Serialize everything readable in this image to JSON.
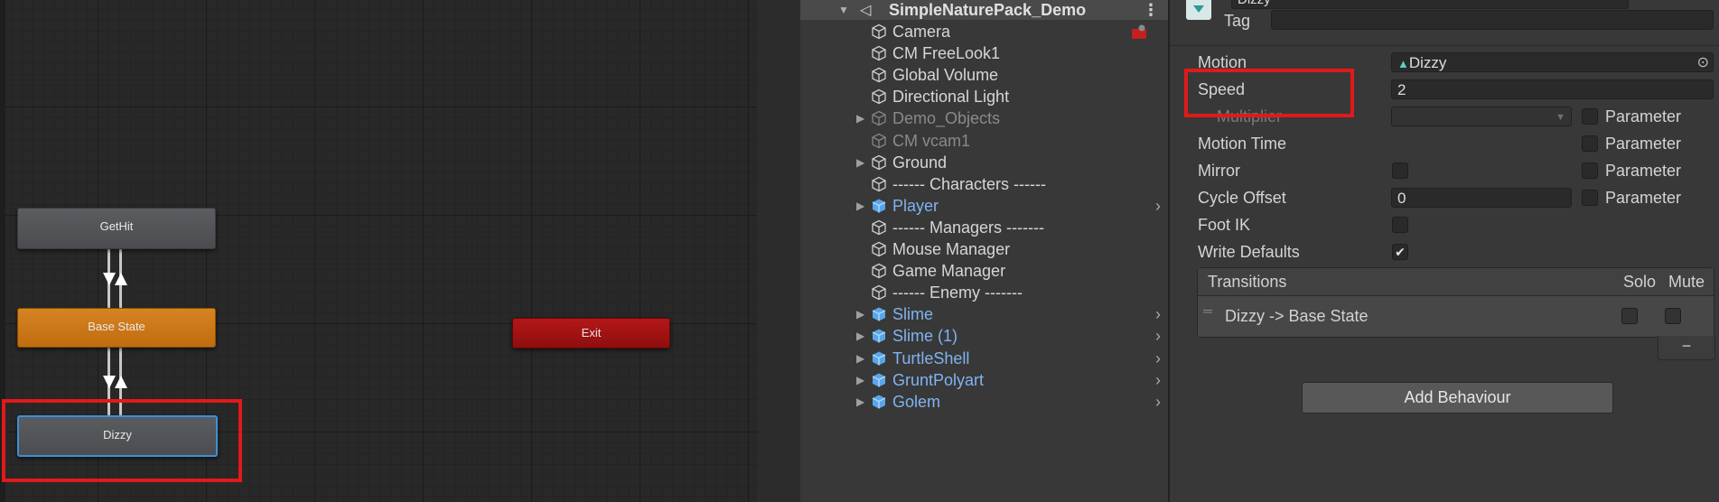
{
  "animator": {
    "states": {
      "gethit": "GetHit",
      "base": "Base State",
      "dizzy": "Dizzy",
      "exit": "Exit"
    }
  },
  "hierarchy": {
    "scene_title": "SimpleNaturePack_Demo",
    "items": [
      {
        "name": "Camera",
        "state": "normal",
        "foldable": false,
        "badge": "camera-gizmo-icon"
      },
      {
        "name": "CM FreeLook1",
        "state": "normal",
        "foldable": false
      },
      {
        "name": "Global Volume",
        "state": "normal",
        "foldable": false
      },
      {
        "name": "Directional Light",
        "state": "normal",
        "foldable": false
      },
      {
        "name": "Demo_Objects",
        "state": "inactive",
        "foldable": true
      },
      {
        "name": "CM vcam1",
        "state": "inactive",
        "foldable": false
      },
      {
        "name": "Ground",
        "state": "normal",
        "foldable": true
      },
      {
        "name": "------ Characters ------",
        "state": "normal",
        "foldable": false
      },
      {
        "name": "Player",
        "state": "prefab",
        "foldable": true,
        "chevron": true
      },
      {
        "name": "------ Managers -------",
        "state": "normal",
        "foldable": false
      },
      {
        "name": "Mouse Manager",
        "state": "normal",
        "foldable": false
      },
      {
        "name": "Game Manager",
        "state": "normal",
        "foldable": false
      },
      {
        "name": "------ Enemy -------",
        "state": "normal",
        "foldable": false
      },
      {
        "name": "Slime",
        "state": "prefab",
        "foldable": true,
        "chevron": true
      },
      {
        "name": "Slime (1)",
        "state": "prefab",
        "foldable": true,
        "chevron": true
      },
      {
        "name": "TurtleShell",
        "state": "prefab",
        "foldable": true,
        "chevron": true
      },
      {
        "name": "GruntPolyart",
        "state": "prefab",
        "foldable": true,
        "chevron": true
      },
      {
        "name": "Golem",
        "state": "prefab",
        "foldable": true,
        "chevron": true
      }
    ]
  },
  "inspector": {
    "state_name": "Dizzy",
    "tag_label": "Tag",
    "tag_value": "",
    "motion_label": "Motion",
    "motion_value": "Dizzy",
    "speed_label": "Speed",
    "speed_value": "2",
    "multiplier_label": "Multiplier",
    "motion_time_label": "Motion Time",
    "mirror_label": "Mirror",
    "cycle_offset_label": "Cycle Offset",
    "cycle_offset_value": "0",
    "foot_ik_label": "Foot IK",
    "write_defaults_label": "Write Defaults",
    "parameter_label": "Parameter",
    "mirror_checked": false,
    "foot_ik_checked": false,
    "write_defaults_checked": true,
    "transitions": {
      "header": "Transitions",
      "solo": "Solo",
      "mute": "Mute",
      "row": "Dizzy -> Base State"
    },
    "add_behaviour": "Add Behaviour",
    "minus": "−"
  }
}
